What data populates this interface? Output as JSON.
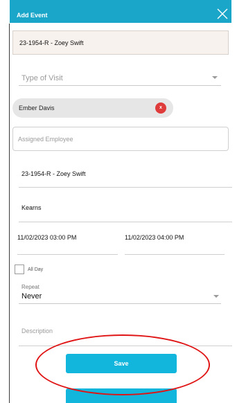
{
  "dialog": {
    "title": "Add Event",
    "linked_record": "23-1954-R - Zoey Swift"
  },
  "visit_type": {
    "placeholder": "Type of Visit"
  },
  "attendee_chip": {
    "name": "Ember Davis",
    "remove_label": "x"
  },
  "assigned_employee": {
    "placeholder": "Assigned Employee"
  },
  "event_title": {
    "value": "23-1954-R - Zoey Swift"
  },
  "location": {
    "value": "Kearns"
  },
  "start_datetime": {
    "value": "11/02/2023 03:00 PM"
  },
  "end_datetime": {
    "value": "11/02/2023 04:00 PM"
  },
  "all_day": {
    "label": "All Day",
    "checked": false
  },
  "repeat": {
    "label": "Repeat",
    "value": "Never"
  },
  "description": {
    "placeholder": "Description"
  },
  "actions": {
    "save_label": "Save"
  },
  "colors": {
    "header": "#1aa6c9",
    "primary_button": "#12b5dc",
    "chip_remove": "#e03b3b",
    "annotation": "#e01414"
  },
  "icons": {
    "close": "close-icon",
    "dropdown": "chevron-down-icon"
  }
}
